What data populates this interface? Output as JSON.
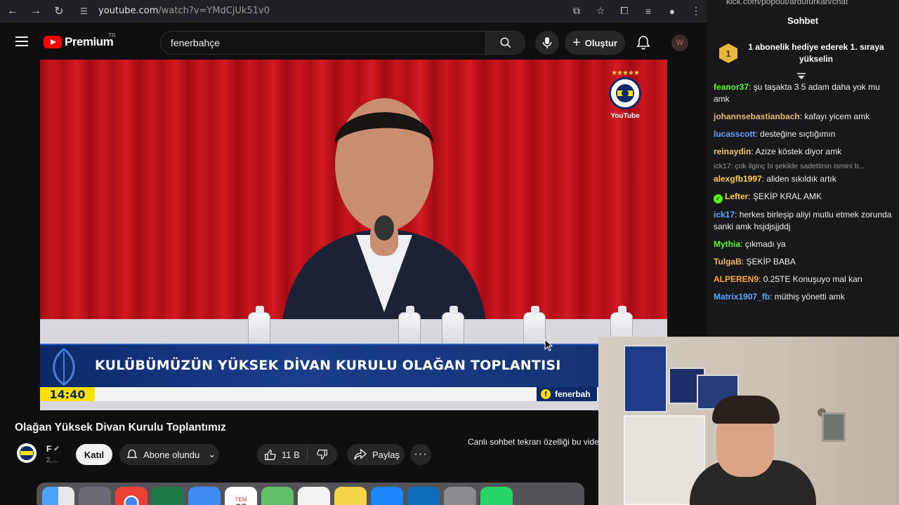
{
  "browser": {
    "url_host": "youtube.com",
    "url_path": "/watch?v=YMdCjUk51v0"
  },
  "youtube": {
    "logo_text": "Premium",
    "logo_region": "TR",
    "search_value": "fenerbahçe",
    "create_label": "Oluştur"
  },
  "video": {
    "lower_third": "KULÜBÜMÜZÜN YÜKSEK DİVAN KURULU OLAĞAN TOPLANTISI",
    "clock": "14:40",
    "brand": "fenerbah",
    "corner_logo_label": "YouTube"
  },
  "below": {
    "title": "Olağan Yüksek Divan Kurulu Toplantımız",
    "channel_name": "F",
    "channel_subs": "2,...",
    "join_label": "Katıl",
    "subscribed_label": "Abone olundu",
    "like_count": "11 B",
    "share_label": "Paylaş",
    "chat_replay_notice": "Canlı sohbet tekrarı özelliği bu vide"
  },
  "chat": {
    "url": "kick.com/popout/ardufurkan/chat",
    "title": "Sohbet",
    "pinned_rank": "1",
    "pinned_text": "1 abonelik hediye ederek 1. sıraya yükselin",
    "messages": [
      {
        "user": "feanor37",
        "color": "#53fc18",
        "text": "şu taşakta 3 5 adam daha yok mu amk"
      },
      {
        "user": "johannsebastianbach",
        "color": "#e8b96a",
        "text": "kafayı yicem amk"
      },
      {
        "user": "lucasscott",
        "color": "#5aa6ff",
        "text": "desteğine sıçtığımın"
      },
      {
        "user": "reinaydin",
        "color": "#f0c85a",
        "text": "Azize köstek diyor amk"
      },
      {
        "reply": "ick17: çok ilginç bi şekilde sadettinin ismini b..."
      },
      {
        "user": "alexgfb1997",
        "color": "#ffd23c",
        "text": "aliden sıkıldık artık"
      },
      {
        "user": "Lefter",
        "color": "#ffd23c",
        "verified": true,
        "text": "ŞEKİP KRAL AMK"
      },
      {
        "user": "ick17",
        "color": "#5aa6ff",
        "text": "herkes birleşip aliyi mutlu etmek zorunda sanki amk hsjdjsjjddj"
      },
      {
        "user": "Mythia",
        "color": "#53fc18",
        "text": "çıkmadı ya"
      },
      {
        "user": "TulgaB",
        "color": "#e8b96a",
        "text": "ŞEKİP BABA"
      },
      {
        "user": "ALPEREN9",
        "color": "#ffa726",
        "text": "0.25TE Konuşuyo mal karı"
      },
      {
        "user": "Matrix1907_fb",
        "color": "#5aa6ff",
        "text": "müthiş yönetti amk"
      }
    ]
  },
  "dock": {
    "calendar_month": "TEM",
    "calendar_day": "27"
  },
  "colors": {
    "yt_red": "#ff0000",
    "kick_green": "#53fc18",
    "fb_navy": "#0c2a6a",
    "fb_yellow": "#ffe100"
  }
}
